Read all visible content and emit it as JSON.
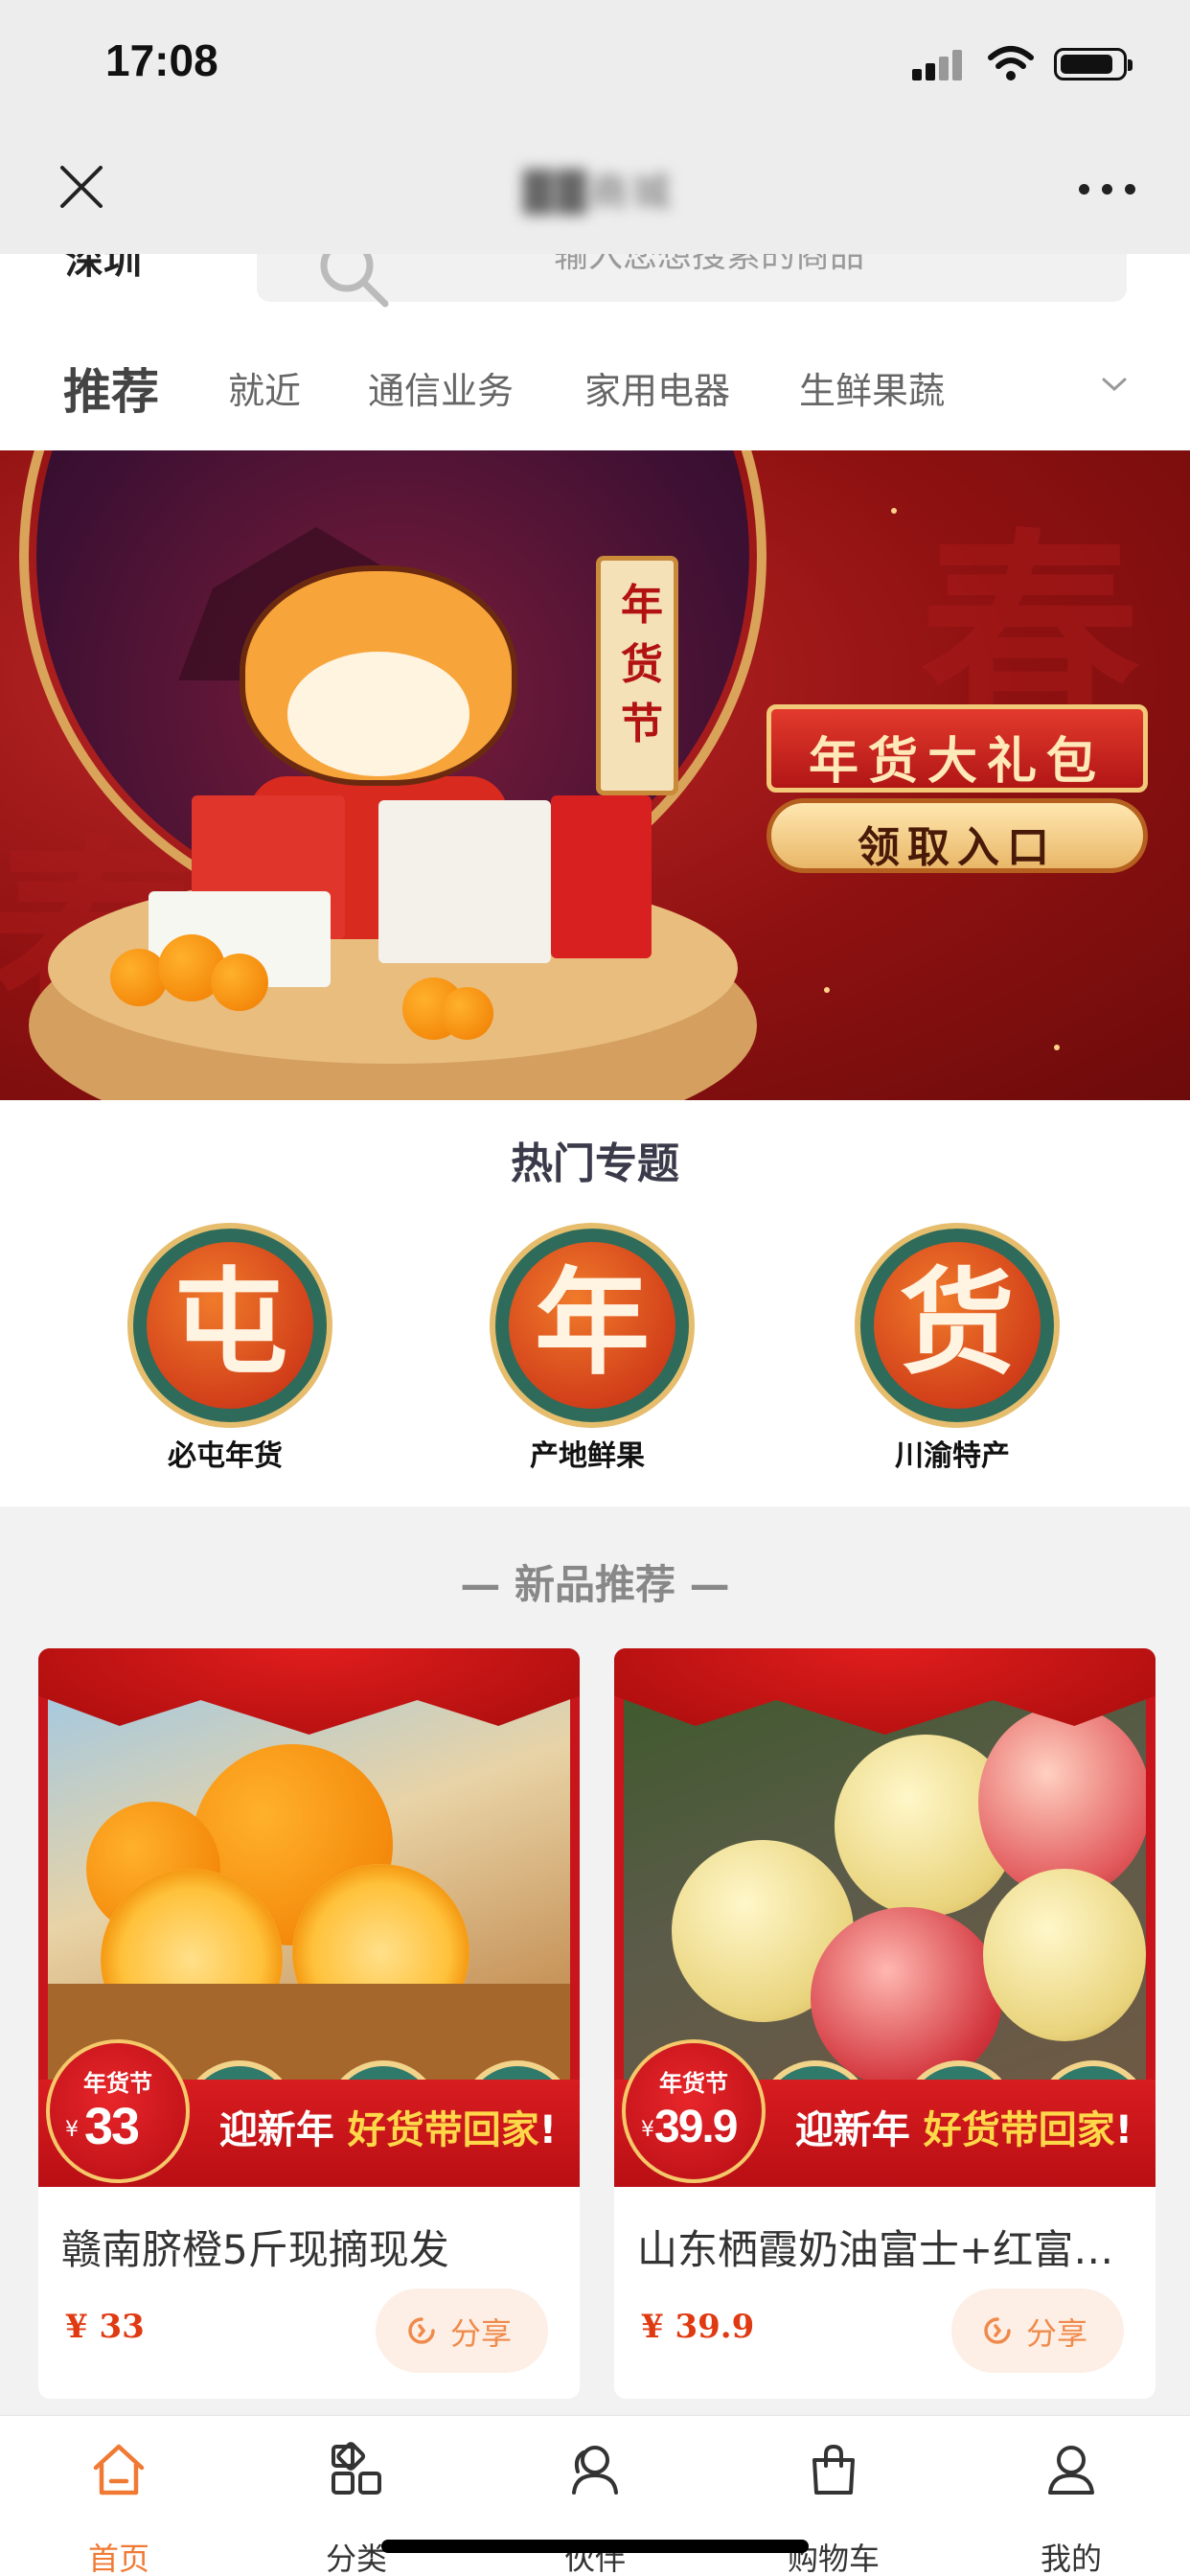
{
  "status_bar": {
    "time": "17:08",
    "battery_level": 0.85
  },
  "nav": {
    "title": "██商城"
  },
  "search": {
    "location": "深圳",
    "placeholder": "输入您想搜索的商品"
  },
  "tabs": [
    "推荐",
    "就近",
    "通信业务",
    "家用电器",
    "生鲜果蔬"
  ],
  "banner": {
    "festival_sign": "年货节",
    "gift_title": "年货大礼包",
    "gift_button": "领取入口",
    "brush_char": "春"
  },
  "hot_topics": {
    "title": "热门专题",
    "items": [
      {
        "char": "屯",
        "label": "必屯年货"
      },
      {
        "char": "年",
        "label": "产地鲜果"
      },
      {
        "char": "货",
        "label": "川渝特产"
      }
    ]
  },
  "new_products": {
    "title": "— 新品推荐 —",
    "promo_prefix": "迎新年",
    "promo_highlight": "好货带回家",
    "promo_suffix": "!",
    "badge_label": "年货节",
    "currency": "¥",
    "share_label": "分享",
    "items": [
      {
        "name": "赣南脐橙5斤现摘现发",
        "badge_price": "33",
        "price": "¥ 33"
      },
      {
        "name": "山东栖霞奶油富士+红富士苹果",
        "badge_price": "39.9",
        "price": "¥ 39.9"
      }
    ]
  },
  "tab_bar": [
    {
      "label": "首页",
      "icon": "home-icon",
      "active": true
    },
    {
      "label": "分类",
      "icon": "category-icon"
    },
    {
      "label": "伙伴",
      "icon": "partner-icon"
    },
    {
      "label": "购物车",
      "icon": "cart-icon"
    },
    {
      "label": "我的",
      "icon": "profile-icon"
    }
  ],
  "colors": {
    "accent": "#f07a34",
    "promo_red": "#c8151b",
    "price_red": "#e03a12"
  }
}
